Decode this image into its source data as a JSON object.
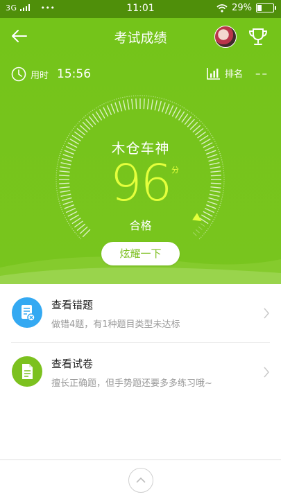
{
  "status_bar": {
    "network": "3G",
    "more": "•••",
    "time": "11:01",
    "battery_percent": "29%",
    "battery_level": 0.29
  },
  "header": {
    "title": "考试成绩",
    "time_label": "用时",
    "time_value": "15:56",
    "rank_label": "排名",
    "rank_value": "––"
  },
  "result": {
    "rank_name": "木仓车神",
    "score": "96",
    "score_unit": "分",
    "score_max": 100,
    "status": "合格",
    "share_label": "炫耀一下"
  },
  "list": {
    "items": [
      {
        "title": "查看错题",
        "desc": "做错4题，有1种题目类型未达标",
        "icon": "wrong-questions-icon",
        "icon_color": "#34a9f2"
      },
      {
        "title": "查看试卷",
        "desc": "擅长正确题，但手势题还要多多练习哦~",
        "icon": "exam-paper-icon",
        "icon_color": "#7cc11f"
      }
    ]
  },
  "colors": {
    "header_bg": "#77c31c",
    "score_color": "#e4ff3c",
    "accent_blue": "#34a9f2",
    "accent_green": "#7cc11f"
  }
}
